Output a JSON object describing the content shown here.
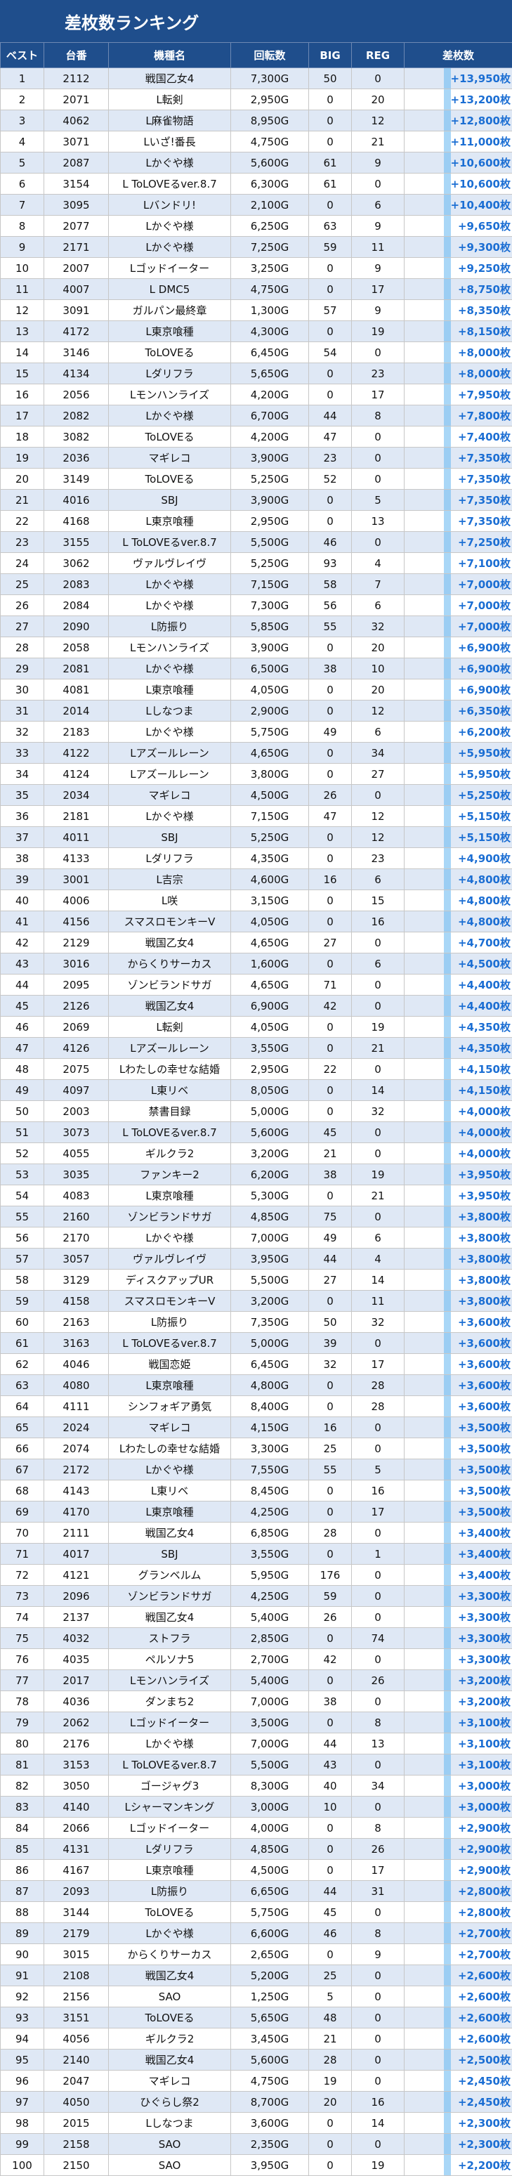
{
  "title": "差枚数ランキング",
  "colors": {
    "header_bg": "#1f4e8c",
    "row_alt": "#dfe8f5",
    "diff_text": "#1b6ed3",
    "diff_bar": "#62b7f0"
  },
  "headers": [
    "ベスト",
    "台番",
    "機種名",
    "回転数",
    "BIG",
    "REG",
    "差枚数"
  ],
  "rows": [
    [
      "1",
      "2112",
      "戦国乙女4",
      "7,300G",
      "50",
      "0",
      "+13,950枚"
    ],
    [
      "2",
      "2071",
      "L転剣",
      "2,950G",
      "0",
      "20",
      "+13,200枚"
    ],
    [
      "3",
      "4062",
      "L麻雀物語",
      "8,950G",
      "0",
      "12",
      "+12,800枚"
    ],
    [
      "4",
      "3071",
      "Lいざ!番長",
      "4,750G",
      "0",
      "21",
      "+11,000枚"
    ],
    [
      "5",
      "2087",
      "Lかぐや様",
      "5,600G",
      "61",
      "9",
      "+10,600枚"
    ],
    [
      "6",
      "3154",
      "L ToLOVEるver.8.7",
      "6,300G",
      "61",
      "0",
      "+10,600枚"
    ],
    [
      "7",
      "3095",
      "Lバンドリ!",
      "2,100G",
      "0",
      "6",
      "+10,400枚"
    ],
    [
      "8",
      "2077",
      "Lかぐや様",
      "6,250G",
      "63",
      "9",
      "+9,650枚"
    ],
    [
      "9",
      "2171",
      "Lかぐや様",
      "7,250G",
      "59",
      "11",
      "+9,300枚"
    ],
    [
      "10",
      "2007",
      "Lゴッドイーター",
      "3,250G",
      "0",
      "9",
      "+9,250枚"
    ],
    [
      "11",
      "4007",
      "L DMC5",
      "4,750G",
      "0",
      "17",
      "+8,750枚"
    ],
    [
      "12",
      "3091",
      "ガルパン最終章",
      "1,300G",
      "57",
      "9",
      "+8,350枚"
    ],
    [
      "13",
      "4172",
      "L東京喰種",
      "4,300G",
      "0",
      "19",
      "+8,150枚"
    ],
    [
      "14",
      "3146",
      "ToLOVEる",
      "6,450G",
      "54",
      "0",
      "+8,000枚"
    ],
    [
      "15",
      "4134",
      "Lダリフラ",
      "5,650G",
      "0",
      "23",
      "+8,000枚"
    ],
    [
      "16",
      "2056",
      "Lモンハンライズ",
      "4,200G",
      "0",
      "17",
      "+7,950枚"
    ],
    [
      "17",
      "2082",
      "Lかぐや様",
      "6,700G",
      "44",
      "8",
      "+7,800枚"
    ],
    [
      "18",
      "3082",
      "ToLOVEる",
      "4,200G",
      "47",
      "0",
      "+7,400枚"
    ],
    [
      "19",
      "2036",
      "マギレコ",
      "3,900G",
      "23",
      "0",
      "+7,350枚"
    ],
    [
      "20",
      "3149",
      "ToLOVEる",
      "5,250G",
      "52",
      "0",
      "+7,350枚"
    ],
    [
      "21",
      "4016",
      "SBJ",
      "3,900G",
      "0",
      "5",
      "+7,350枚"
    ],
    [
      "22",
      "4168",
      "L東京喰種",
      "2,950G",
      "0",
      "13",
      "+7,350枚"
    ],
    [
      "23",
      "3155",
      "L ToLOVEるver.8.7",
      "5,500G",
      "46",
      "0",
      "+7,250枚"
    ],
    [
      "24",
      "3062",
      "ヴァルヴレイヴ",
      "5,250G",
      "93",
      "4",
      "+7,100枚"
    ],
    [
      "25",
      "2083",
      "Lかぐや様",
      "7,150G",
      "58",
      "7",
      "+7,000枚"
    ],
    [
      "26",
      "2084",
      "Lかぐや様",
      "7,300G",
      "56",
      "6",
      "+7,000枚"
    ],
    [
      "27",
      "2090",
      "L防振り",
      "5,850G",
      "55",
      "32",
      "+7,000枚"
    ],
    [
      "28",
      "2058",
      "Lモンハンライズ",
      "3,900G",
      "0",
      "20",
      "+6,900枚"
    ],
    [
      "29",
      "2081",
      "Lかぐや様",
      "6,500G",
      "38",
      "10",
      "+6,900枚"
    ],
    [
      "30",
      "4081",
      "L東京喰種",
      "4,050G",
      "0",
      "20",
      "+6,900枚"
    ],
    [
      "31",
      "2014",
      "Lしなつま",
      "2,900G",
      "0",
      "12",
      "+6,350枚"
    ],
    [
      "32",
      "2183",
      "Lかぐや様",
      "5,750G",
      "49",
      "6",
      "+6,200枚"
    ],
    [
      "33",
      "4122",
      "Lアズールレーン",
      "4,650G",
      "0",
      "34",
      "+5,950枚"
    ],
    [
      "34",
      "4124",
      "Lアズールレーン",
      "3,800G",
      "0",
      "27",
      "+5,950枚"
    ],
    [
      "35",
      "2034",
      "マギレコ",
      "4,500G",
      "26",
      "0",
      "+5,250枚"
    ],
    [
      "36",
      "2181",
      "Lかぐや様",
      "7,150G",
      "47",
      "12",
      "+5,150枚"
    ],
    [
      "37",
      "4011",
      "SBJ",
      "5,250G",
      "0",
      "12",
      "+5,150枚"
    ],
    [
      "38",
      "4133",
      "Lダリフラ",
      "4,350G",
      "0",
      "23",
      "+4,900枚"
    ],
    [
      "39",
      "3001",
      "L吉宗",
      "4,600G",
      "16",
      "6",
      "+4,800枚"
    ],
    [
      "40",
      "4006",
      "L咲",
      "3,150G",
      "0",
      "15",
      "+4,800枚"
    ],
    [
      "41",
      "4156",
      "スマスロモンキーV",
      "4,050G",
      "0",
      "16",
      "+4,800枚"
    ],
    [
      "42",
      "2129",
      "戦国乙女4",
      "4,650G",
      "27",
      "0",
      "+4,700枚"
    ],
    [
      "43",
      "3016",
      "からくりサーカス",
      "1,600G",
      "0",
      "6",
      "+4,500枚"
    ],
    [
      "44",
      "2095",
      "ゾンビランドサガ",
      "4,650G",
      "71",
      "0",
      "+4,400枚"
    ],
    [
      "45",
      "2126",
      "戦国乙女4",
      "6,900G",
      "42",
      "0",
      "+4,400枚"
    ],
    [
      "46",
      "2069",
      "L転剣",
      "4,050G",
      "0",
      "19",
      "+4,350枚"
    ],
    [
      "47",
      "4126",
      "Lアズールレーン",
      "3,550G",
      "0",
      "21",
      "+4,350枚"
    ],
    [
      "48",
      "2075",
      "Lわたしの幸せな結婚",
      "2,950G",
      "22",
      "0",
      "+4,150枚"
    ],
    [
      "49",
      "4097",
      "L東リベ",
      "8,050G",
      "0",
      "14",
      "+4,150枚"
    ],
    [
      "50",
      "2003",
      "禁書目録",
      "5,000G",
      "0",
      "32",
      "+4,000枚"
    ],
    [
      "51",
      "3073",
      "L ToLOVEるver.8.7",
      "5,600G",
      "45",
      "0",
      "+4,000枚"
    ],
    [
      "52",
      "4055",
      "ギルクラ2",
      "3,200G",
      "21",
      "0",
      "+4,000枚"
    ],
    [
      "53",
      "3035",
      "ファンキー2",
      "6,200G",
      "38",
      "19",
      "+3,950枚"
    ],
    [
      "54",
      "4083",
      "L東京喰種",
      "5,300G",
      "0",
      "21",
      "+3,950枚"
    ],
    [
      "55",
      "2160",
      "ゾンビランドサガ",
      "4,850G",
      "75",
      "0",
      "+3,800枚"
    ],
    [
      "56",
      "2170",
      "Lかぐや様",
      "7,000G",
      "49",
      "6",
      "+3,800枚"
    ],
    [
      "57",
      "3057",
      "ヴァルヴレイヴ",
      "3,950G",
      "44",
      "4",
      "+3,800枚"
    ],
    [
      "58",
      "3129",
      "ディスクアップUR",
      "5,500G",
      "27",
      "14",
      "+3,800枚"
    ],
    [
      "59",
      "4158",
      "スマスロモンキーV",
      "3,200G",
      "0",
      "11",
      "+3,800枚"
    ],
    [
      "60",
      "2163",
      "L防振り",
      "7,350G",
      "50",
      "32",
      "+3,600枚"
    ],
    [
      "61",
      "3163",
      "L ToLOVEるver.8.7",
      "5,000G",
      "39",
      "0",
      "+3,600枚"
    ],
    [
      "62",
      "4046",
      "戦国恋姫",
      "6,450G",
      "32",
      "17",
      "+3,600枚"
    ],
    [
      "63",
      "4080",
      "L東京喰種",
      "4,800G",
      "0",
      "28",
      "+3,600枚"
    ],
    [
      "64",
      "4111",
      "シンフォギア勇気",
      "8,400G",
      "0",
      "28",
      "+3,600枚"
    ],
    [
      "65",
      "2024",
      "マギレコ",
      "4,150G",
      "16",
      "0",
      "+3,500枚"
    ],
    [
      "66",
      "2074",
      "Lわたしの幸せな結婚",
      "3,300G",
      "25",
      "0",
      "+3,500枚"
    ],
    [
      "67",
      "2172",
      "Lかぐや様",
      "7,550G",
      "55",
      "5",
      "+3,500枚"
    ],
    [
      "68",
      "4143",
      "L東リベ",
      "8,450G",
      "0",
      "16",
      "+3,500枚"
    ],
    [
      "69",
      "4170",
      "L東京喰種",
      "4,250G",
      "0",
      "17",
      "+3,500枚"
    ],
    [
      "70",
      "2111",
      "戦国乙女4",
      "6,850G",
      "28",
      "0",
      "+3,400枚"
    ],
    [
      "71",
      "4017",
      "SBJ",
      "3,550G",
      "0",
      "1",
      "+3,400枚"
    ],
    [
      "72",
      "4121",
      "グランベルム",
      "5,950G",
      "176",
      "0",
      "+3,400枚"
    ],
    [
      "73",
      "2096",
      "ゾンビランドサガ",
      "4,250G",
      "59",
      "0",
      "+3,300枚"
    ],
    [
      "74",
      "2137",
      "戦国乙女4",
      "5,400G",
      "26",
      "0",
      "+3,300枚"
    ],
    [
      "75",
      "4032",
      "ストフラ",
      "2,850G",
      "0",
      "74",
      "+3,300枚"
    ],
    [
      "76",
      "4035",
      "ペルソナ5",
      "2,700G",
      "42",
      "0",
      "+3,300枚"
    ],
    [
      "77",
      "2017",
      "Lモンハンライズ",
      "5,400G",
      "0",
      "26",
      "+3,200枚"
    ],
    [
      "78",
      "4036",
      "ダンまち2",
      "7,000G",
      "38",
      "0",
      "+3,200枚"
    ],
    [
      "79",
      "2062",
      "Lゴッドイーター",
      "3,500G",
      "0",
      "8",
      "+3,100枚"
    ],
    [
      "80",
      "2176",
      "Lかぐや様",
      "7,000G",
      "44",
      "13",
      "+3,100枚"
    ],
    [
      "81",
      "3153",
      "L ToLOVEるver.8.7",
      "5,500G",
      "43",
      "0",
      "+3,100枚"
    ],
    [
      "82",
      "3050",
      "ゴージャグ3",
      "8,300G",
      "40",
      "34",
      "+3,000枚"
    ],
    [
      "83",
      "4140",
      "Lシャーマンキング",
      "3,000G",
      "10",
      "0",
      "+3,000枚"
    ],
    [
      "84",
      "2066",
      "Lゴッドイーター",
      "4,000G",
      "0",
      "8",
      "+2,900枚"
    ],
    [
      "85",
      "4131",
      "Lダリフラ",
      "4,850G",
      "0",
      "26",
      "+2,900枚"
    ],
    [
      "86",
      "4167",
      "L東京喰種",
      "4,500G",
      "0",
      "17",
      "+2,900枚"
    ],
    [
      "87",
      "2093",
      "L防振り",
      "6,650G",
      "44",
      "31",
      "+2,800枚"
    ],
    [
      "88",
      "3144",
      "ToLOVEる",
      "5,750G",
      "45",
      "0",
      "+2,800枚"
    ],
    [
      "89",
      "2179",
      "Lかぐや様",
      "6,600G",
      "46",
      "8",
      "+2,700枚"
    ],
    [
      "90",
      "3015",
      "からくりサーカス",
      "2,650G",
      "0",
      "9",
      "+2,700枚"
    ],
    [
      "91",
      "2108",
      "戦国乙女4",
      "5,200G",
      "25",
      "0",
      "+2,600枚"
    ],
    [
      "92",
      "2156",
      "SAO",
      "1,250G",
      "5",
      "0",
      "+2,600枚"
    ],
    [
      "93",
      "3151",
      "ToLOVEる",
      "5,650G",
      "48",
      "0",
      "+2,600枚"
    ],
    [
      "94",
      "4056",
      "ギルクラ2",
      "3,450G",
      "21",
      "0",
      "+2,600枚"
    ],
    [
      "95",
      "2140",
      "戦国乙女4",
      "5,600G",
      "28",
      "0",
      "+2,500枚"
    ],
    [
      "96",
      "2047",
      "マギレコ",
      "4,750G",
      "19",
      "0",
      "+2,450枚"
    ],
    [
      "97",
      "4050",
      "ひぐらし祭2",
      "8,700G",
      "20",
      "16",
      "+2,450枚"
    ],
    [
      "98",
      "2015",
      "Lしなつま",
      "3,600G",
      "0",
      "14",
      "+2,300枚"
    ],
    [
      "99",
      "2158",
      "SAO",
      "2,350G",
      "0",
      "0",
      "+2,300枚"
    ],
    [
      "100",
      "2150",
      "SAO",
      "3,950G",
      "0",
      "19",
      "+2,200枚"
    ]
  ]
}
